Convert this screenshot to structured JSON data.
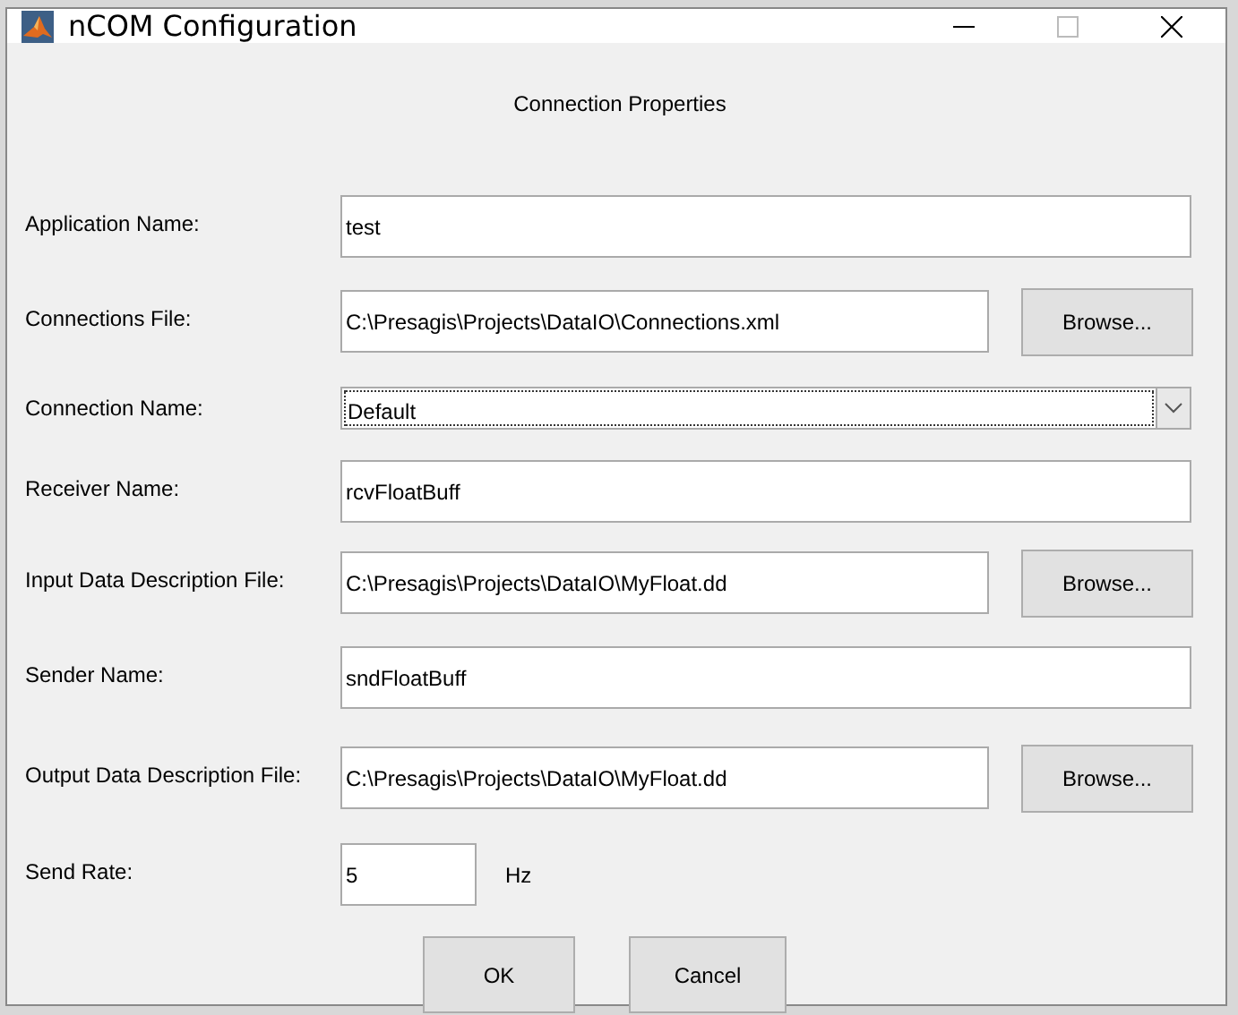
{
  "window": {
    "title": "nCOM Configuration"
  },
  "heading": "Connection Properties",
  "fields": [
    {
      "kind": "text",
      "label": "Application Name:",
      "value": "test"
    },
    {
      "kind": "file",
      "label": "Connections File:",
      "value": "C:\\Presagis\\Projects\\DataIO\\Connections.xml",
      "button": "Browse..."
    },
    {
      "kind": "dropdown",
      "label": "Connection Name:",
      "value": "Default"
    },
    {
      "kind": "text",
      "label": "Receiver Name:",
      "value": "rcvFloatBuff"
    },
    {
      "kind": "file",
      "label": "Input Data Description File:",
      "value": "C:\\Presagis\\Projects\\DataIO\\MyFloat.dd",
      "button": "Browse..."
    },
    {
      "kind": "text",
      "label": "Sender Name:",
      "value": "sndFloatBuff"
    },
    {
      "kind": "file",
      "label": "Output Data Description File:",
      "value": "C:\\Presagis\\Projects\\DataIO\\MyFloat.dd",
      "button": "Browse..."
    },
    {
      "kind": "rate",
      "label": "Send Rate:",
      "value": "5",
      "unit": "Hz"
    }
  ],
  "buttons": [
    "OK",
    "Cancel"
  ]
}
